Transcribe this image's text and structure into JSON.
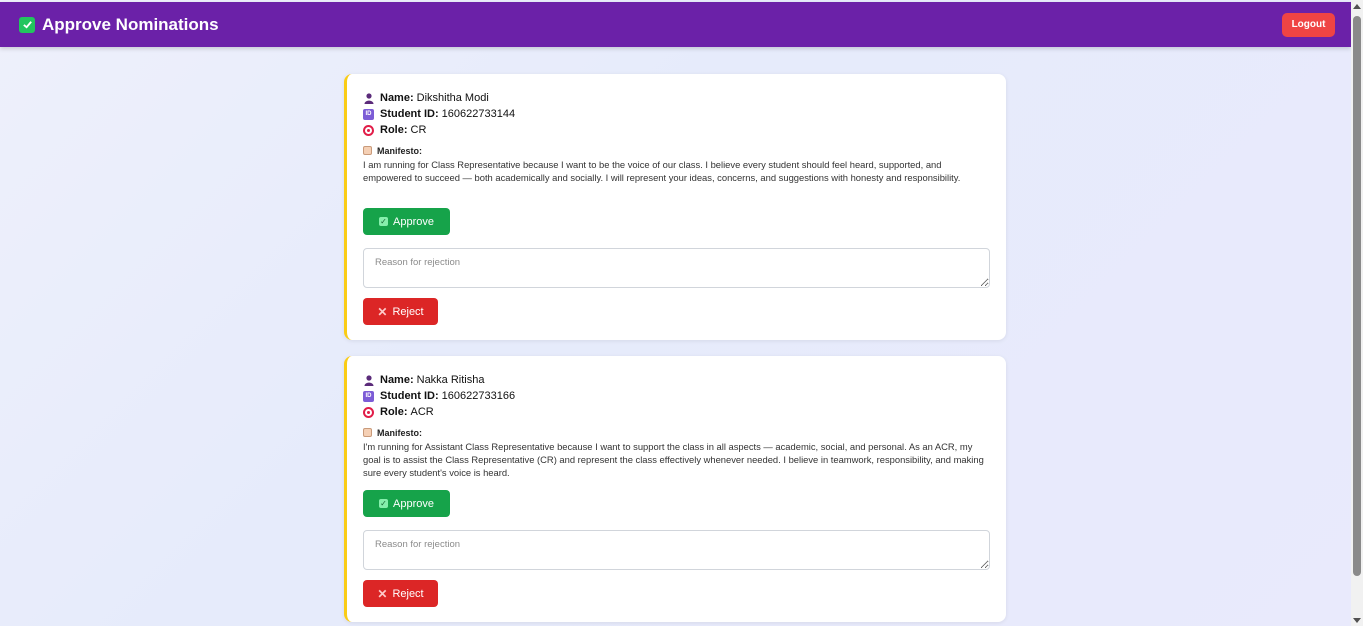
{
  "header": {
    "title": "Approve Nominations",
    "logout_label": "Logout",
    "bar_color": "#6b21a8"
  },
  "nominations": [
    {
      "name_label": "Name:",
      "name": "Dikshitha Modi",
      "id_label": "Student ID:",
      "student_id": "160622733144",
      "role_label": "Role:",
      "role": "CR",
      "manifesto_label": "Manifesto:",
      "manifesto": "I am running for Class Representative because I want to be the voice of our class. I believe every student should feel heard, supported, and empowered to succeed — both academically and socially. I will represent your ideas, concerns, and suggestions with honesty and responsibility.",
      "approve_label": "Approve",
      "reason_placeholder": "Reason for rejection",
      "reject_label": "Reject"
    },
    {
      "name_label": "Name:",
      "name": "Nakka Ritisha",
      "id_label": "Student ID:",
      "student_id": "160622733166",
      "role_label": "Role:",
      "role": "ACR",
      "manifesto_label": "Manifesto:",
      "manifesto": "I'm running for Assistant Class Representative because I want to support the class in all aspects — academic, social, and personal. As an ACR, my goal is to assist the Class Representative (CR) and represent the class effectively whenever needed. I believe in teamwork, responsibility, and making sure every student's voice is heard.",
      "approve_label": "Approve",
      "reason_placeholder": "Reason for rejection",
      "reject_label": "Reject"
    }
  ],
  "icons": {
    "brand": "check-box-icon",
    "name": "person-icon",
    "student_id": "id-badge-icon",
    "role": "target-icon",
    "manifesto": "scroll-icon",
    "approve": "check-box-icon",
    "reject": "cross-icon"
  },
  "colors": {
    "approve": "#16a34a",
    "reject": "#dc2626",
    "logout": "#ef4444",
    "card_accent": "#facc15"
  }
}
